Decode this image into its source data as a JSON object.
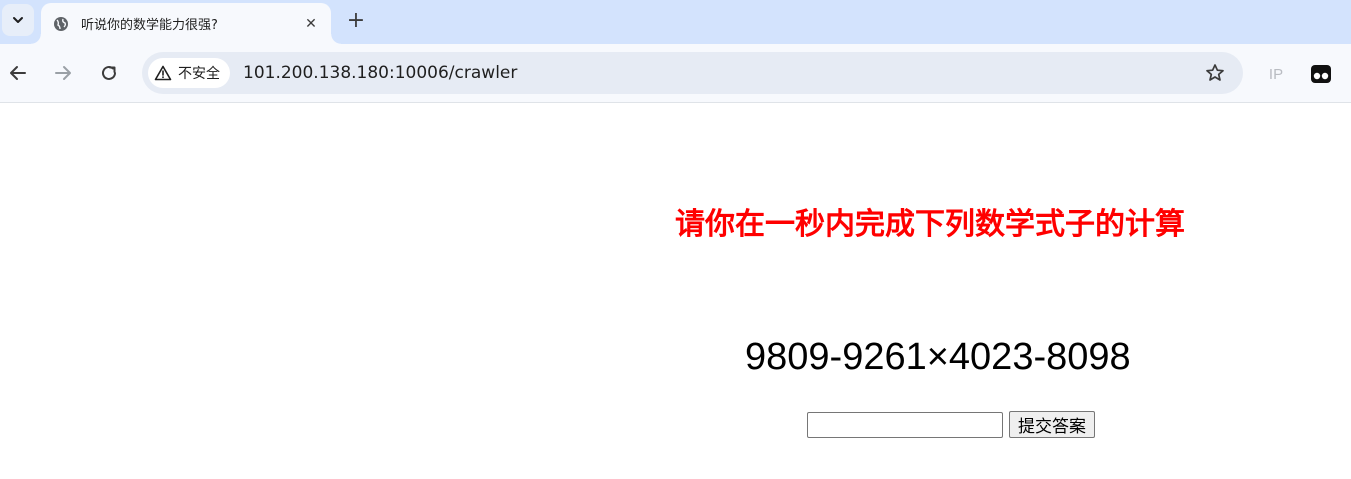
{
  "browser": {
    "tab": {
      "title": "听说你的数学能力很强?",
      "close": "✕"
    },
    "new_tab": "+",
    "security_label": "不安全",
    "url": "101.200.138.180:10006/crawler",
    "extension_ip": "IP"
  },
  "page": {
    "headline": "请你在一秒内完成下列数学式子的计算",
    "expression": "9809-9261×4023-8098",
    "answer_value": "",
    "submit_label": "提交答案"
  }
}
